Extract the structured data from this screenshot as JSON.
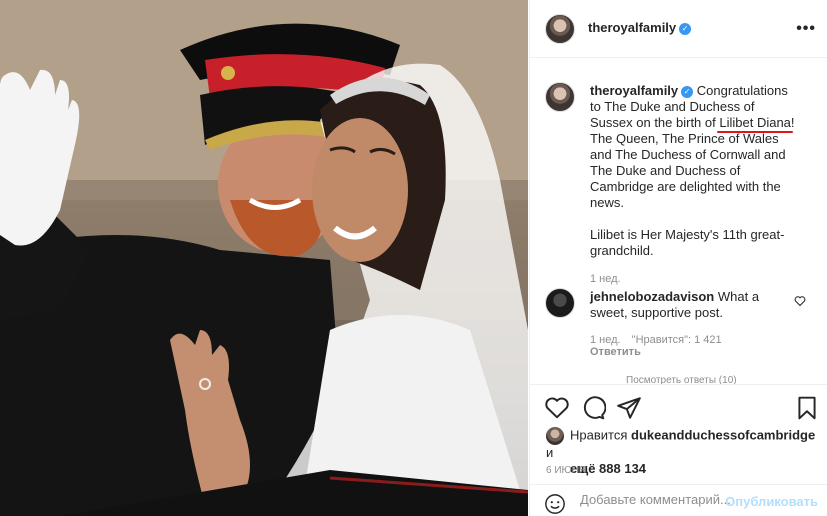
{
  "post": {
    "author": "theroyalfamily",
    "caption_line1": "Congratulations to The Duke and Duchess of Sussex on the birth of ",
    "caption_highlight": "Lilibet Diana",
    "caption_line1_end": "!",
    "caption_line2": "The Queen, The Prince of Wales and The Duchess of Cornwall and The Duke and Duchess of Cambridge are delighted with the news.",
    "caption_line3": "Lilibet is Her Majesty's 11th great-grandchild.",
    "caption_time": "1 нед."
  },
  "comment": {
    "author": "jehnelobozadavison",
    "text": "What a sweet, supportive post.",
    "time": "1 нед.",
    "likes": "\"Нравится\": 1 421",
    "reply": "Ответить",
    "view_replies": "Посмотреть ответы (10)"
  },
  "likes": {
    "prefix": "Нравится",
    "user": "dukeandduchessofcambridge",
    "conj": "и",
    "others": "ещё 888 134"
  },
  "date": "6 ИЮНЯ",
  "add_comment": {
    "placeholder": "Добавьте комментарий...",
    "publish": "Опубликовать"
  },
  "colors": {
    "verified": "#3897f0",
    "highlight": "#e0141d",
    "publish": "#b2dffc"
  },
  "icons": [
    "more-icon",
    "heart-icon",
    "comment-icon",
    "share-icon",
    "bookmark-icon",
    "smile-icon",
    "verified-icon"
  ]
}
